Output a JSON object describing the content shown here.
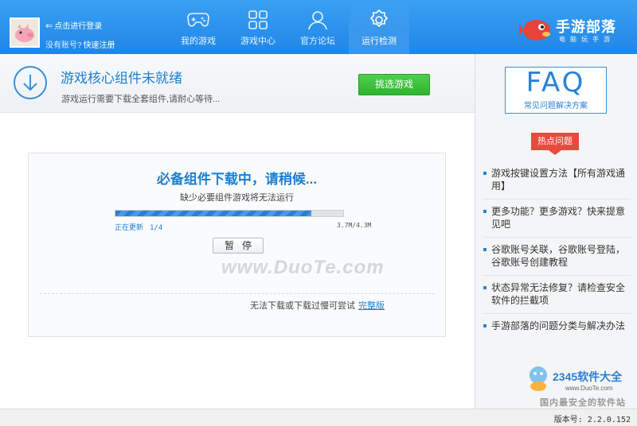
{
  "header": {
    "login_text": "点击进行登录",
    "no_account_text": "没有账号?",
    "register_link": "快速注册",
    "tabs": [
      {
        "label": "我的游戏",
        "icon": "gamepad-icon"
      },
      {
        "label": "游戏中心",
        "icon": "grid-icon"
      },
      {
        "label": "官方论坛",
        "icon": "user-icon"
      },
      {
        "label": "运行检测",
        "icon": "gear-icon"
      }
    ],
    "active_tab": "运行检测",
    "brand_name": "手游部落",
    "brand_sub": "电脑玩手游"
  },
  "banner": {
    "title": "游戏核心组件未就绪",
    "subtitle": "游戏运行需要下载全套组件,请耐心等待...",
    "pick_button": "挑选游戏"
  },
  "download": {
    "title": "必备组件下载中，请稍候...",
    "subtitle": "缺少必要组件游戏将无法运行",
    "status_label": "正在更新",
    "step": "1/4",
    "size": "3.7M/4.3M",
    "progress": 0.86,
    "pause_button": "暂停",
    "fail_text": "无法下载或下载过慢可尝试",
    "full_link": "完整版"
  },
  "watermark": "www.DuoTe.com",
  "sidebar": {
    "faq_big": "FAQ",
    "faq_small": "常见问题解决方案",
    "hot_label": "热点问题",
    "questions": [
      "游戏按键设置方法【所有游戏通用】",
      "更多功能？更多游戏？快来提意见吧",
      "谷歌账号关联，谷歌账号登陆，谷歌账号创建教程",
      "状态异常无法修复？请检查安全软件的拦截项",
      "手游部落的问题分类与解决办法"
    ]
  },
  "site_brand": {
    "name": "2345软件大全",
    "url": "www.DuoTe.com",
    "slogan": "国内最安全的软件站"
  },
  "footer": {
    "version": "版本号: 2.2.0.152"
  },
  "colors": {
    "header_blue": "#2a8ff0",
    "accent_blue": "#1a7fd3",
    "button_green": "#3bc13b",
    "hot_red": "#e84a3e"
  }
}
